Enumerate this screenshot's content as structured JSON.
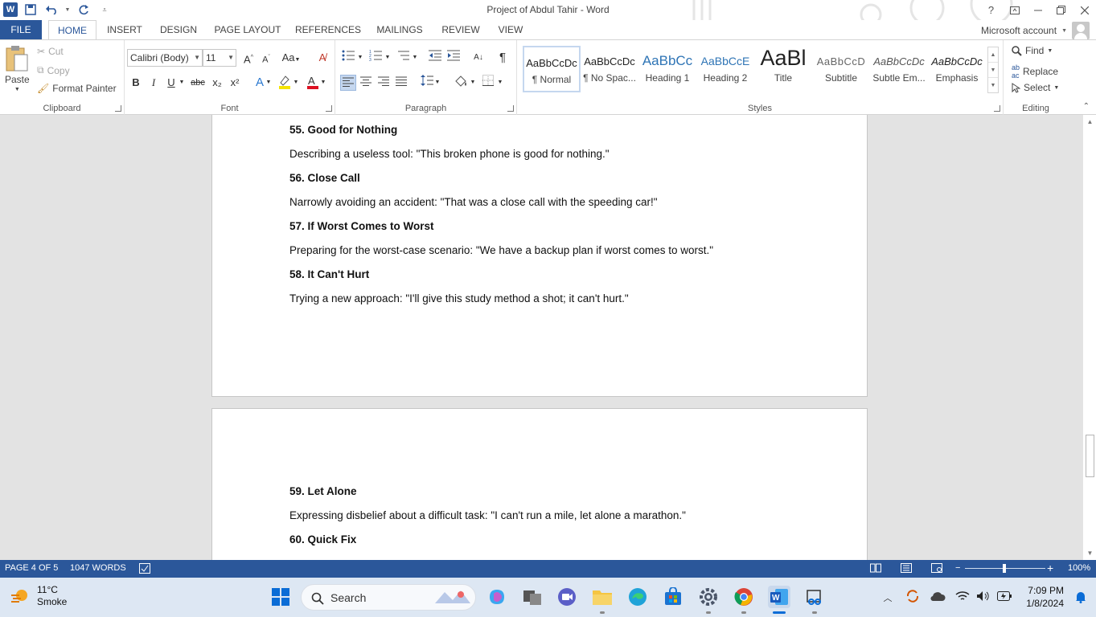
{
  "window": {
    "title": "Project of Abdul Tahir - Word",
    "help": "?"
  },
  "tabs": [
    "FILE",
    "HOME",
    "INSERT",
    "DESIGN",
    "PAGE LAYOUT",
    "REFERENCES",
    "MAILINGS",
    "REVIEW",
    "VIEW"
  ],
  "account": "Microsoft account",
  "clipboard": {
    "paste": "Paste",
    "cut": "Cut",
    "copy": "Copy",
    "format_painter": "Format Painter",
    "label": "Clipboard"
  },
  "font": {
    "name": "Calibri (Body)",
    "size": "11",
    "label": "Font",
    "change_case": "Aa",
    "bold": "B",
    "italic": "I",
    "underline": "U",
    "strike": "abc",
    "subscript": "x₂",
    "superscript": "x²"
  },
  "paragraph": {
    "label": "Paragraph"
  },
  "styles": {
    "label": "Styles",
    "items": [
      {
        "sample": "AaBbCcDc",
        "name": "¶ Normal"
      },
      {
        "sample": "AaBbCcDc",
        "name": "¶ No Spac..."
      },
      {
        "sample": "AaBbCc",
        "name": "Heading 1"
      },
      {
        "sample": "AaBbCcE",
        "name": "Heading 2"
      },
      {
        "sample": "AaBl",
        "name": "Title"
      },
      {
        "sample": "AaBbCcD",
        "name": "Subtitle"
      },
      {
        "sample": "AaBbCcDc",
        "name": "Subtle Em..."
      },
      {
        "sample": "AaBbCcDc",
        "name": "Emphasis"
      }
    ]
  },
  "editing": {
    "find": "Find",
    "replace": "Replace",
    "select": "Select",
    "label": "Editing"
  },
  "document": {
    "page1": [
      {
        "text": "55. Good for Nothing",
        "bold": true
      },
      {
        "text": "Describing a useless tool: \"This broken phone is good for nothing.\"",
        "bold": false
      },
      {
        "text": "56. Close Call",
        "bold": true
      },
      {
        "text": "Narrowly avoiding an accident: \"That was a close call with the speeding car!\"",
        "bold": false
      },
      {
        "text": "57. If Worst Comes to Worst",
        "bold": true
      },
      {
        "text": "Preparing for the worst-case scenario: \"We have a backup plan if worst comes to worst.\"",
        "bold": false
      },
      {
        "text": "58. It Can't Hurt",
        "bold": true
      },
      {
        "text": "Trying a new approach: \"I'll give this study method a shot; it can't hurt.\"",
        "bold": false
      }
    ],
    "page2": [
      {
        "text": "59. Let Alone",
        "bold": true
      },
      {
        "text": "Expressing disbelief about a difficult task: \"I can't run a mile, let alone a marathon.\"",
        "bold": false
      },
      {
        "text": "60. Quick Fix",
        "bold": true
      }
    ]
  },
  "status": {
    "page": "PAGE 4 OF 5",
    "words": "1047 WORDS",
    "zoom": "100%"
  },
  "taskbar": {
    "temperature": "11°C",
    "condition": "Smoke",
    "search": "Search",
    "time": "7:09 PM",
    "date": "1/8/2024"
  },
  "colors": {
    "accent": "#2b579a",
    "taskbar": "#dde7f3"
  }
}
